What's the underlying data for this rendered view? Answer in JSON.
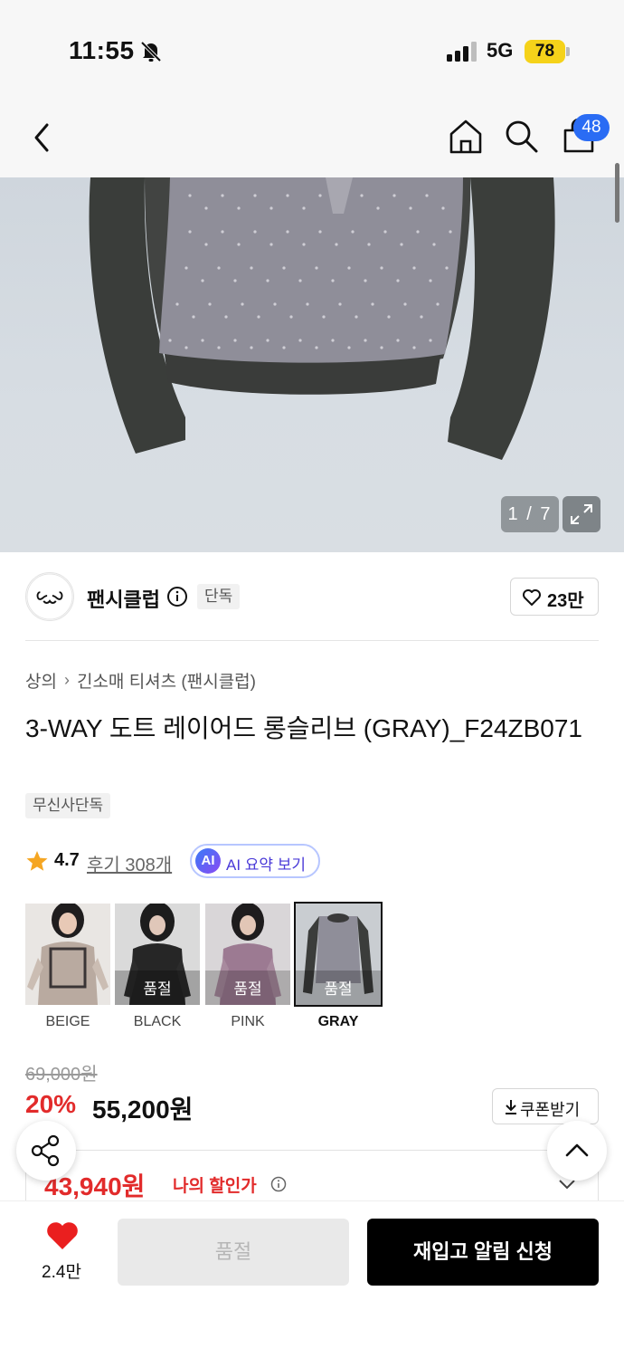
{
  "status_bar": {
    "time": "11:55",
    "network": "5G",
    "battery": "78"
  },
  "header": {
    "cart_count": "48"
  },
  "gallery": {
    "counter": "1 / 7"
  },
  "brand": {
    "name": "팬시클럽",
    "tag": "단독",
    "likes": "23만"
  },
  "breadcrumb": {
    "category": "상의",
    "subcategory": "긴소매 티셔츠 (팬시클럽)"
  },
  "product": {
    "title": "3-WAY 도트 레이어드 롱슬리브 (GRAY)_F24ZB071",
    "exclusive_badge": "무신사단독",
    "rating": "4.7",
    "reviews": "후기 308개",
    "ai_badge": "AI",
    "ai_summary": "AI 요약 보기"
  },
  "colors": [
    {
      "label": "BEIGE",
      "soldout": "",
      "selected": false
    },
    {
      "label": "BLACK",
      "soldout": "품절",
      "selected": false
    },
    {
      "label": "PINK",
      "soldout": "품절",
      "selected": false
    },
    {
      "label": "GRAY",
      "soldout": "품절",
      "selected": true
    }
  ],
  "price": {
    "original": "69,000원",
    "discount": "20%",
    "sale": "55,200원",
    "coupon_label": "쿠폰받기",
    "my_price": "43,940원",
    "my_price_label": "나의 할인가"
  },
  "bottom_bar": {
    "wishlist_count": "2.4만",
    "soldout_label": "품절",
    "restock_label": "재입고 알림 신청"
  },
  "theme": {
    "accent_red": "#e22b2b",
    "badge_blue": "#2a6cf4",
    "button_black": "#000000"
  }
}
